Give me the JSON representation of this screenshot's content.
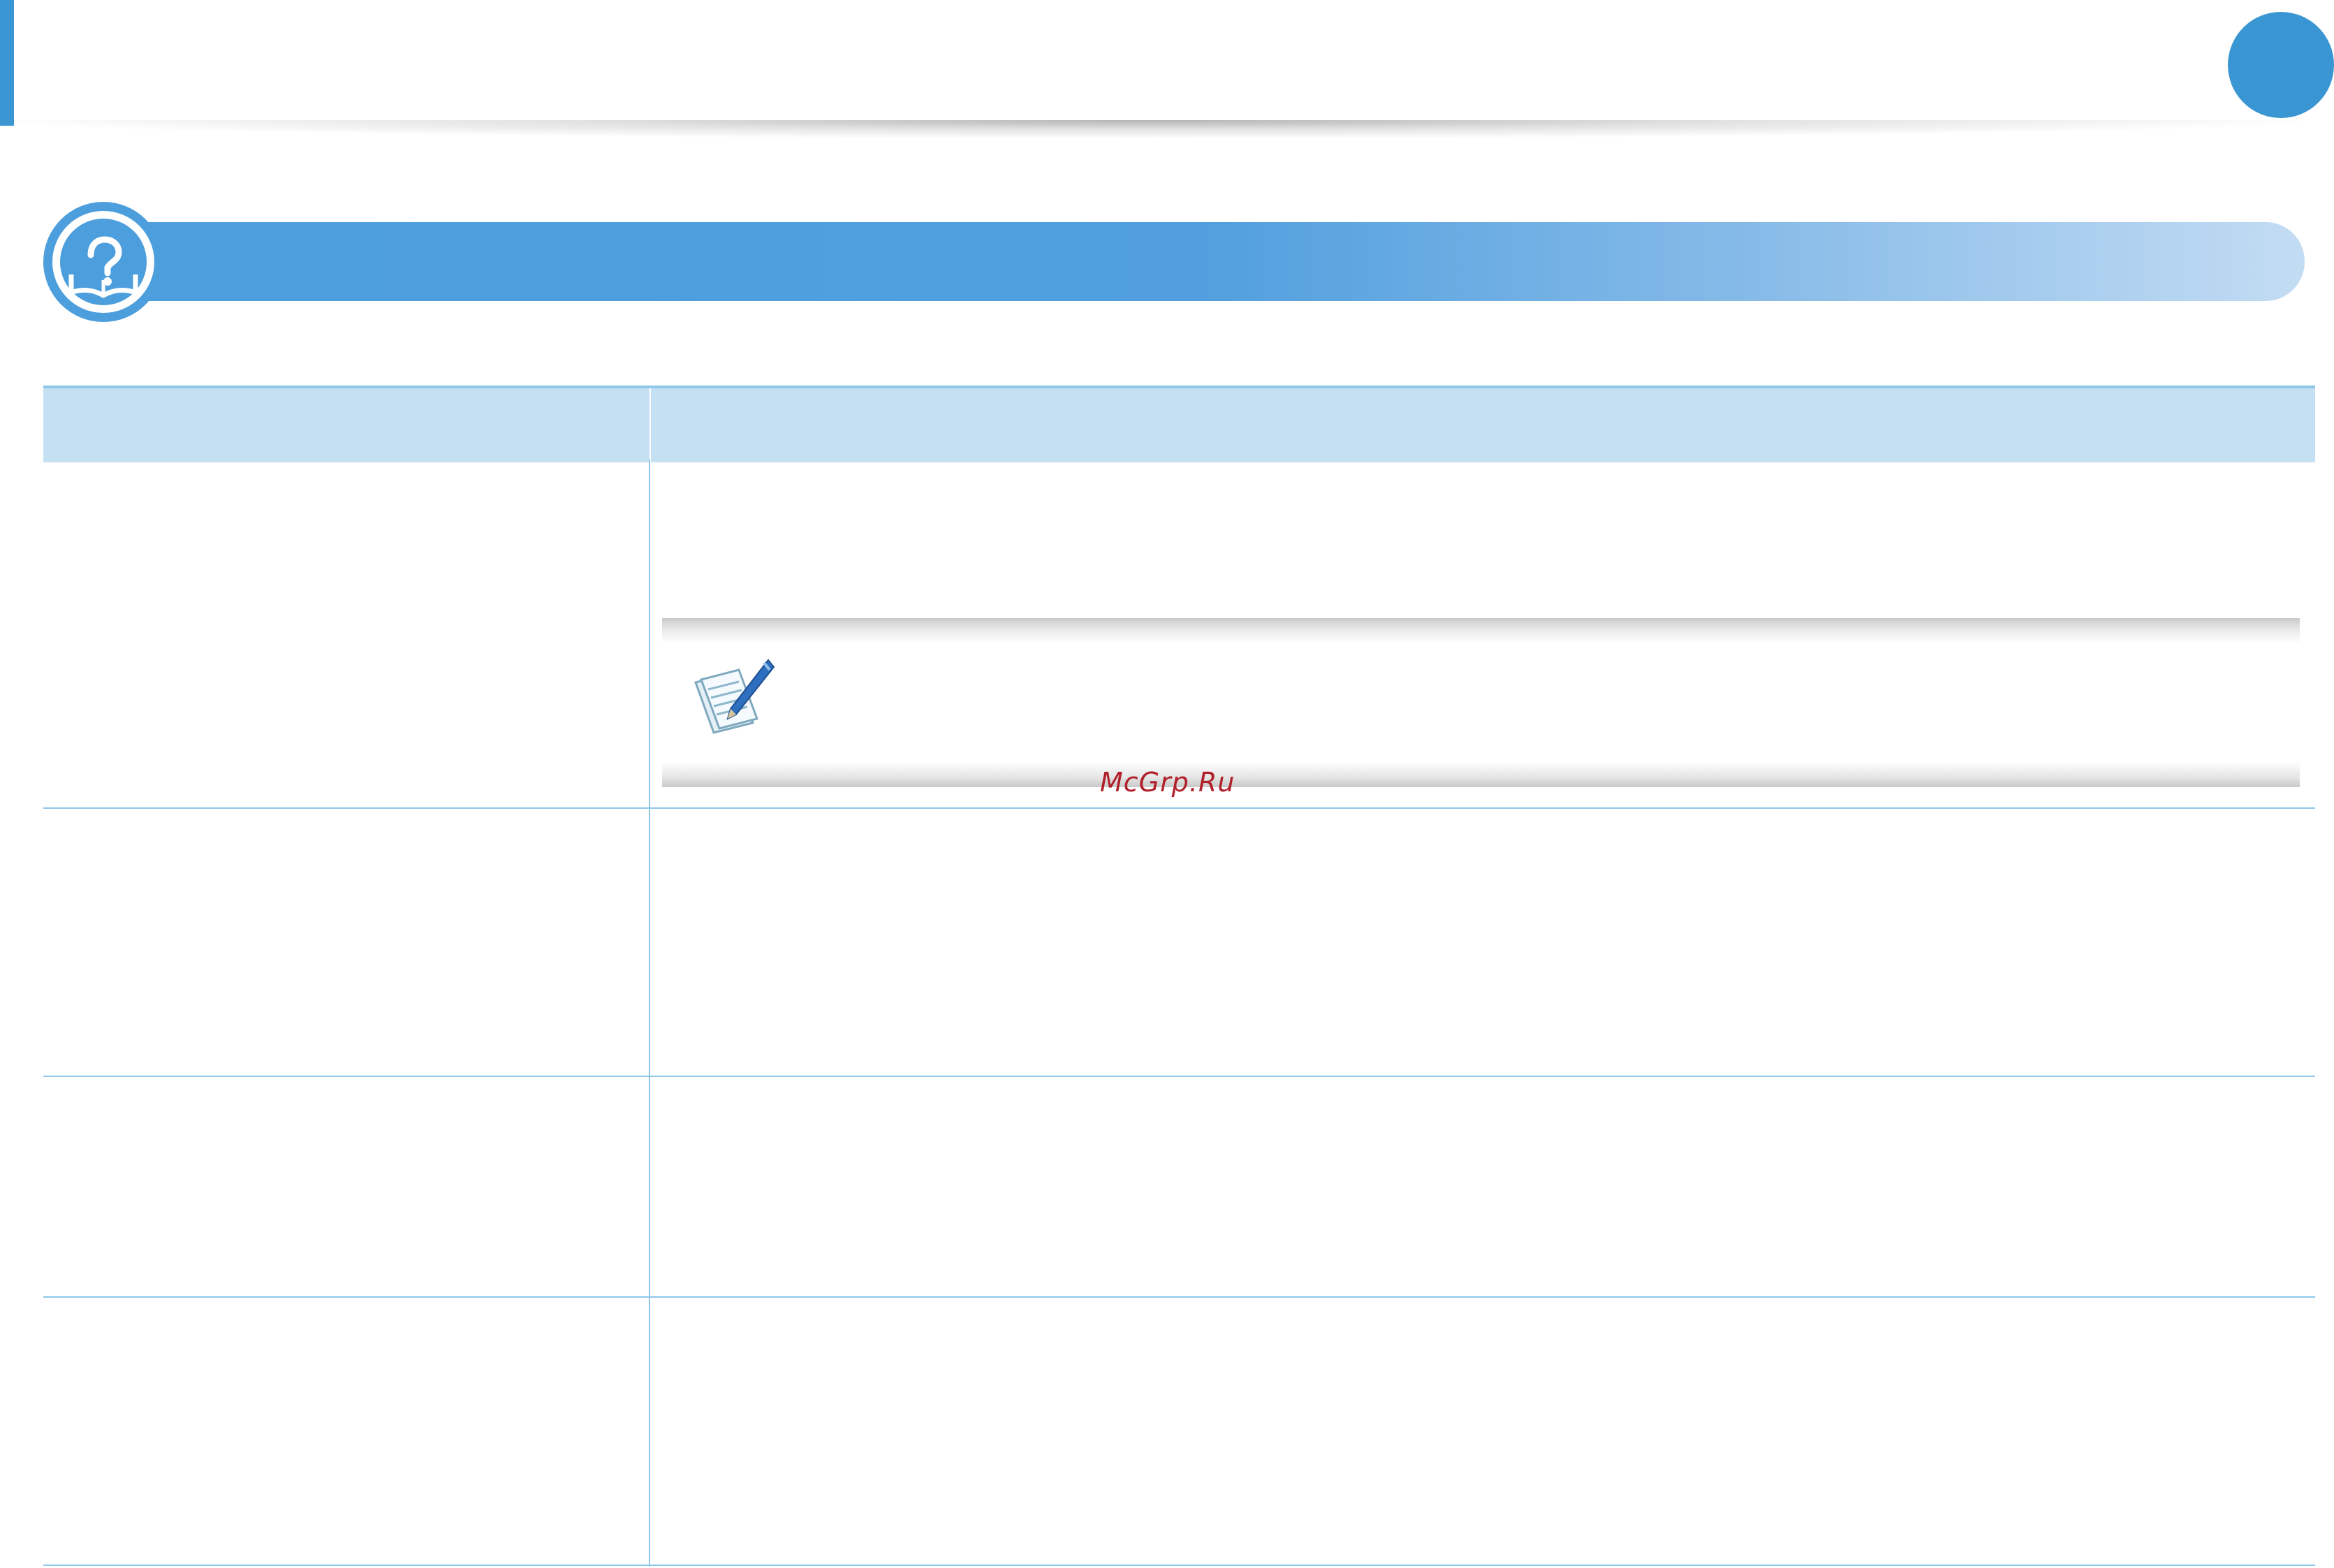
{
  "header": {
    "page_number": ""
  },
  "section": {
    "title": "",
    "icon": "help-book-icon"
  },
  "table": {
    "headers": [
      "",
      ""
    ],
    "rows": [
      {
        "condition": "",
        "solution": ""
      },
      {
        "condition": "",
        "solution": ""
      },
      {
        "condition": "",
        "solution": ""
      },
      {
        "condition": "",
        "solution": ""
      }
    ]
  },
  "note": {
    "icon": "note-pencil-icon",
    "text": ""
  },
  "watermark": {
    "text": "McGrp.Ru"
  },
  "colors": {
    "accent": "#3a96d2",
    "bar_start": "#4c9edd",
    "table_header": "#c4e0f2",
    "rule": "#8ec7ea"
  }
}
